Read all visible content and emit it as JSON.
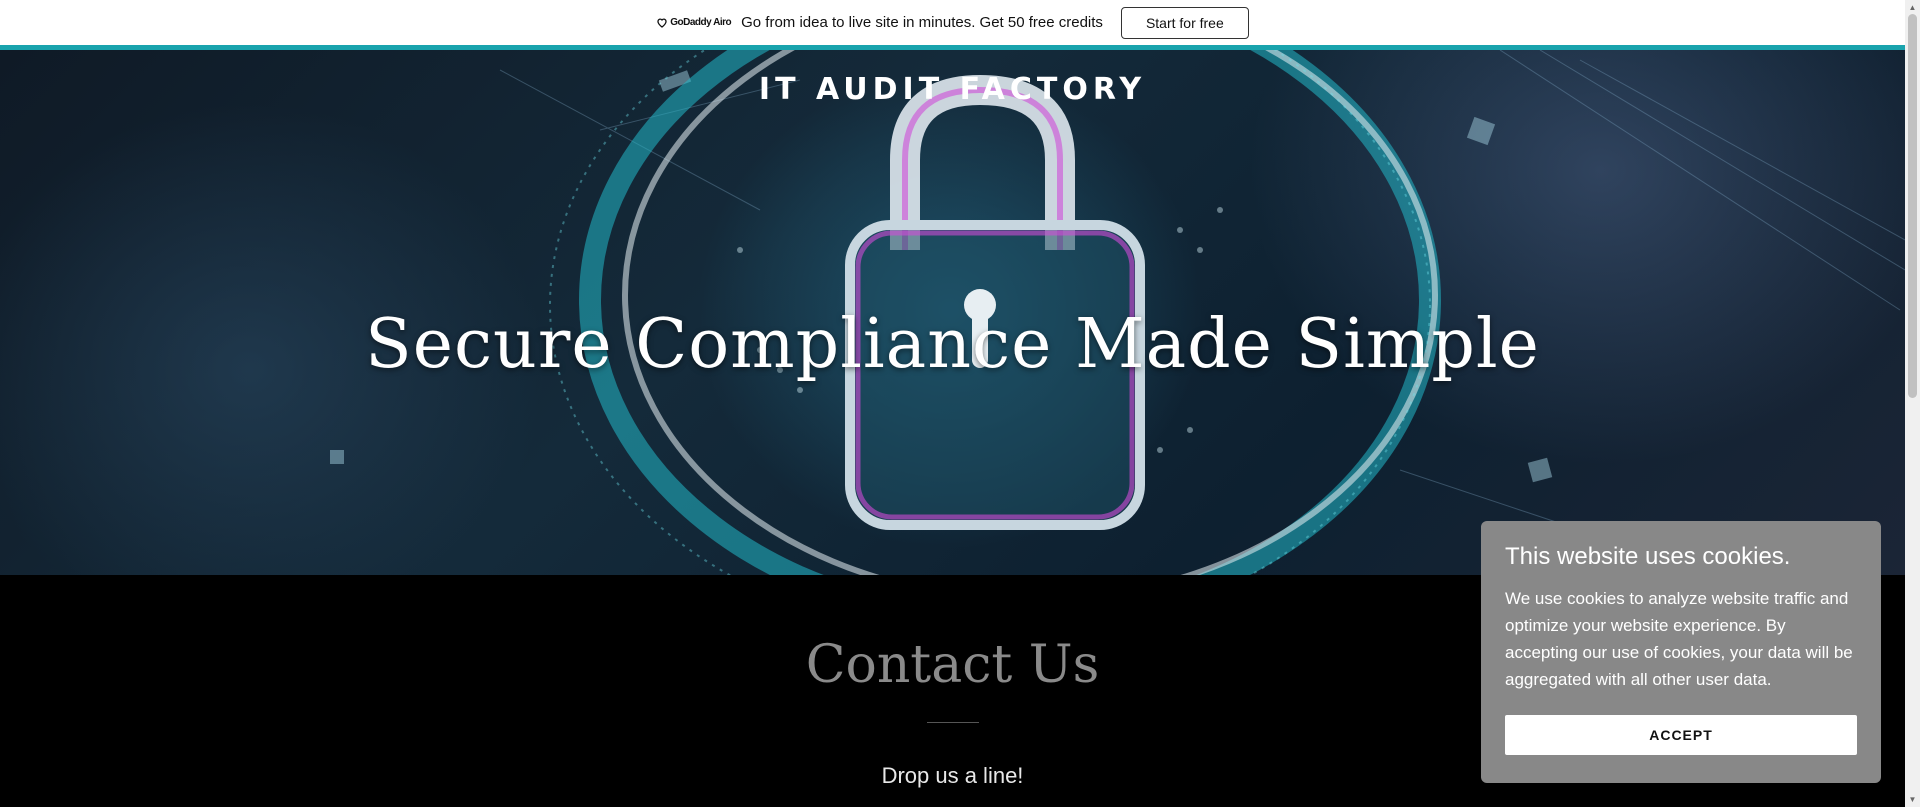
{
  "promo": {
    "logo_text": "GoDaddy Airo",
    "text": "Go from idea to live site in minutes. Get 50 free credits",
    "button_label": "Start for free"
  },
  "hero": {
    "site_title": "IT AUDIT FACTORY",
    "headline": "Secure Compliance Made Simple"
  },
  "contact": {
    "title": "Contact Us",
    "subtitle": "Drop us a line!"
  },
  "cookie_banner": {
    "title": "This website uses cookies.",
    "body": "We use cookies to analyze website traffic and optimize your website experience. By accepting our use of cookies, your data will be aggregated with all other user data.",
    "accept_label": "ACCEPT"
  },
  "colors": {
    "accent": "#19a3ad",
    "cookie_bg": "#888888",
    "contact_title": "#8a8a8a"
  },
  "icons": [
    "godaddy-logo-icon",
    "padlock-icon",
    "scroll-up-arrow-icon",
    "scroll-down-arrow-icon"
  ]
}
